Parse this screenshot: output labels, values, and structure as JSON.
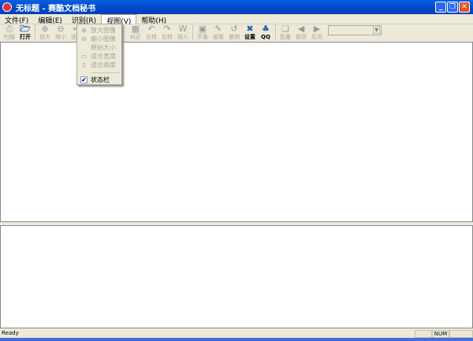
{
  "window": {
    "title": "无标题 - 赛酷文档秘书",
    "minimize": "_",
    "restore": "❐",
    "close": "✕"
  },
  "menu": [
    "文件(F)",
    "编辑(E)",
    "识别(R)",
    "视图(V)",
    "帮助(H)"
  ],
  "toolbar": {
    "group1": [
      {
        "label": "扫描",
        "icon": "scanner-icon",
        "glyph": "⎙",
        "enabled": false
      },
      {
        "label": "打开",
        "icon": "open-icon",
        "glyph": "🗁",
        "enabled": true
      }
    ],
    "group2": [
      {
        "label": "放大",
        "icon": "zoom-in-icon",
        "glyph": "⊕",
        "enabled": false
      },
      {
        "label": "缩小",
        "icon": "zoom-out-icon",
        "glyph": "⊖",
        "enabled": false
      },
      {
        "label": "适宽",
        "icon": "fit-width-icon",
        "glyph": "↔",
        "enabled": false
      }
    ],
    "group3": [
      {
        "label": "纠正",
        "icon": "deskew-icon",
        "glyph": "▦",
        "enabled": false
      },
      {
        "label": "左转",
        "icon": "rotate-left-icon",
        "glyph": "↶",
        "enabled": false
      },
      {
        "label": "右转",
        "icon": "rotate-right-icon",
        "glyph": "↷",
        "enabled": false
      },
      {
        "label": "插入",
        "icon": "insert-icon",
        "glyph": "W",
        "enabled": false
      }
    ],
    "group4": [
      {
        "label": "平衡",
        "icon": "balance-icon",
        "glyph": "▣",
        "enabled": false
      },
      {
        "label": "画笔",
        "icon": "pen-icon",
        "glyph": "✎",
        "enabled": false
      },
      {
        "label": "撤销",
        "icon": "undo-icon",
        "glyph": "↺",
        "enabled": false
      },
      {
        "label": "设置",
        "icon": "settings-icon",
        "glyph": "✖",
        "enabled": true
      },
      {
        "label": "QQ",
        "icon": "qq-icon",
        "glyph": "♣",
        "enabled": true
      }
    ],
    "group5": [
      {
        "label": "批量",
        "icon": "batch-icon",
        "glyph": "❏",
        "enabled": false
      },
      {
        "label": "前页",
        "icon": "prev-page-icon",
        "glyph": "◀",
        "enabled": false
      },
      {
        "label": "后页",
        "icon": "next-page-icon",
        "glyph": "▶",
        "enabled": false
      }
    ]
  },
  "view_menu": [
    {
      "label": "放大图像",
      "glyph": "⊕"
    },
    {
      "label": "缩小图像",
      "glyph": "⊖"
    },
    {
      "label": "原始大小",
      "glyph": ""
    },
    {
      "label": "适合宽度",
      "glyph": "▭"
    },
    {
      "label": "适合高度",
      "glyph": "▯"
    },
    {
      "label": "状态栏",
      "glyph": "✔",
      "checked": true
    }
  ],
  "status": {
    "message": "Ready",
    "num": "NUM"
  }
}
